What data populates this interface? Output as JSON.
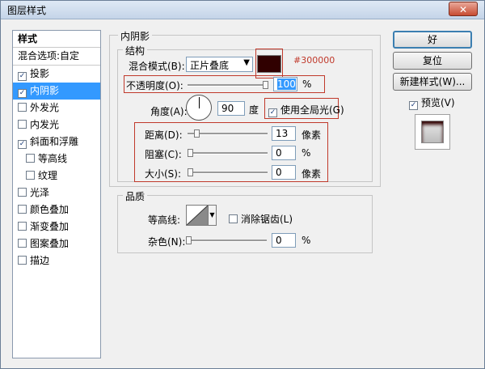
{
  "window": {
    "title": "图层样式",
    "close": "✕"
  },
  "styles_panel": {
    "header": "样式",
    "items": [
      {
        "label": "混合选项:自定",
        "checkbox": false,
        "checked": false,
        "indent": false,
        "selected": false
      },
      {
        "label": "投影",
        "checkbox": true,
        "checked": true,
        "indent": false,
        "selected": false
      },
      {
        "label": "内阴影",
        "checkbox": true,
        "checked": true,
        "indent": false,
        "selected": true
      },
      {
        "label": "外发光",
        "checkbox": true,
        "checked": false,
        "indent": false,
        "selected": false
      },
      {
        "label": "内发光",
        "checkbox": true,
        "checked": false,
        "indent": false,
        "selected": false
      },
      {
        "label": "斜面和浮雕",
        "checkbox": true,
        "checked": true,
        "indent": false,
        "selected": false
      },
      {
        "label": "等高线",
        "checkbox": true,
        "checked": false,
        "indent": true,
        "selected": false
      },
      {
        "label": "纹理",
        "checkbox": true,
        "checked": false,
        "indent": true,
        "selected": false
      },
      {
        "label": "光泽",
        "checkbox": true,
        "checked": false,
        "indent": false,
        "selected": false
      },
      {
        "label": "颜色叠加",
        "checkbox": true,
        "checked": false,
        "indent": false,
        "selected": false
      },
      {
        "label": "渐变叠加",
        "checkbox": true,
        "checked": false,
        "indent": false,
        "selected": false
      },
      {
        "label": "图案叠加",
        "checkbox": true,
        "checked": false,
        "indent": false,
        "selected": false
      },
      {
        "label": "描边",
        "checkbox": true,
        "checked": false,
        "indent": false,
        "selected": false
      }
    ]
  },
  "inner_shadow": {
    "section_title": "内阴影",
    "structure_title": "结构",
    "blend_mode_label": "混合模式(B):",
    "blend_mode_value": "正片叠底",
    "color_hex": "#300000",
    "color_note": "#300000",
    "opacity_label": "不透明度(O):",
    "opacity_value": "100",
    "opacity_fraction": 1.0,
    "percent": "%",
    "angle_label": "角度(A):",
    "angle_value": "90",
    "angle_unit": "度",
    "global_light_label": "使用全局光(G)",
    "global_light_checked": true,
    "distance_label": "距离(D):",
    "distance_value": "13",
    "distance_fraction": 0.09,
    "choke_label": "阻塞(C):",
    "choke_value": "0",
    "size_label": "大小(S):",
    "size_value": "0",
    "pixels_unit": "像素"
  },
  "quality": {
    "title": "品质",
    "contour_label": "等高线:",
    "antialias_label": "消除锯齿(L)",
    "antialias_checked": false,
    "noise_label": "杂色(N):",
    "noise_value": "0"
  },
  "buttons": {
    "ok": "好",
    "reset": "复位",
    "new_style": "新建样式(W)...",
    "preview_label": "预览(V)",
    "preview_checked": true
  },
  "colors": {
    "accent": "#3399ff",
    "highlight_box": "#c0392b",
    "shadow": "#300000"
  }
}
